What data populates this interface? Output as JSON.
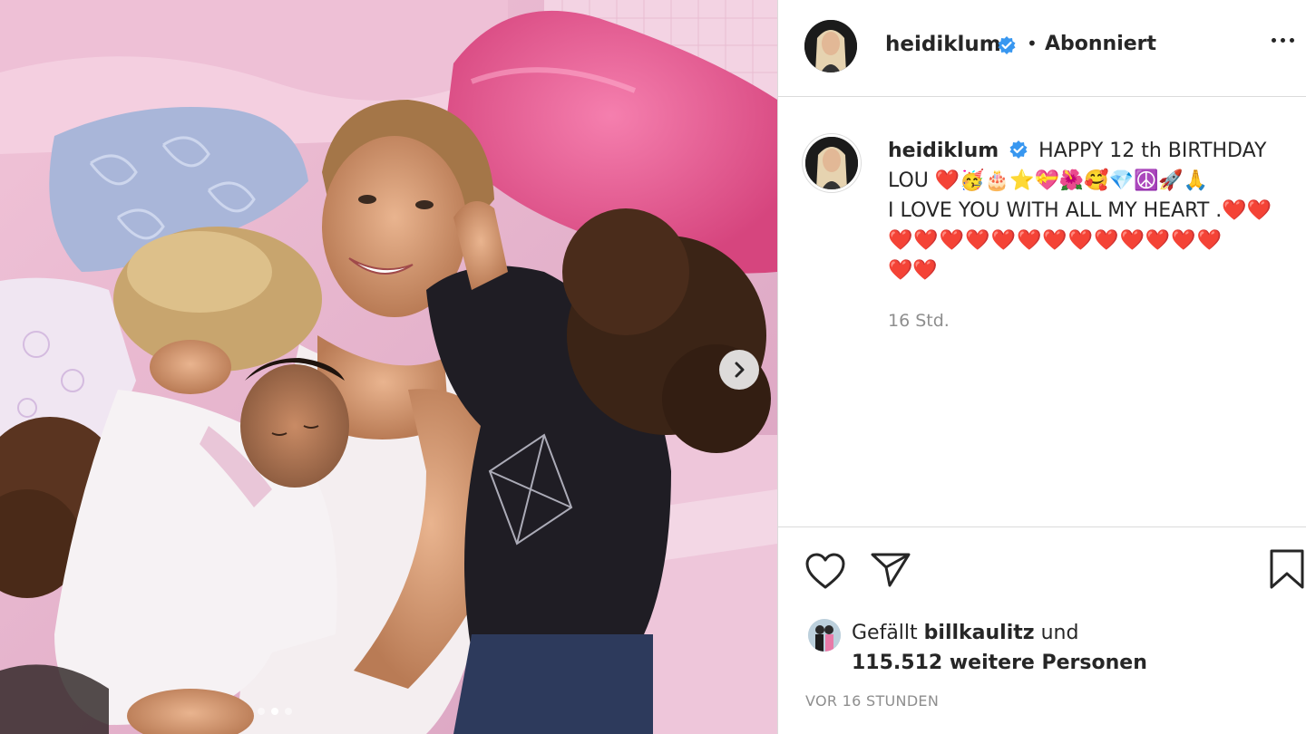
{
  "post": {
    "username": "heidiklum",
    "follow_status": "Abonniert",
    "separator": "•",
    "caption_line_1": "HAPPY 12 th BIRTHDAY",
    "caption_line_2": "LOU ❤️🥳🎂⭐💝🌺🥰💎☮️🚀🙏",
    "caption_line_3": "I LOVE YOU WITH ALL MY HEART .❤️❤️",
    "caption_line_4": "❤️❤️❤️❤️❤️❤️❤️❤️❤️❤️❤️❤️❤️",
    "caption_line_5": "❤️❤️",
    "relative_time": "16 Std.",
    "likes_prefix": "Gefällt",
    "likes_user": "billkaulitz",
    "likes_and": "und",
    "likes_others": "115.512 weitere Personen",
    "post_date": "VOR 16 STUNDEN"
  },
  "carousel": {
    "slide_count": 3,
    "active_slide": 2
  },
  "colors": {
    "verified": "#3897f0",
    "text": "#262626",
    "muted": "#8e8e8e",
    "border": "#dbdbdb"
  },
  "icons": [
    "verified-badge-icon",
    "more-options-icon",
    "carousel-next-icon",
    "heart-icon",
    "share-icon",
    "bookmark-icon"
  ]
}
